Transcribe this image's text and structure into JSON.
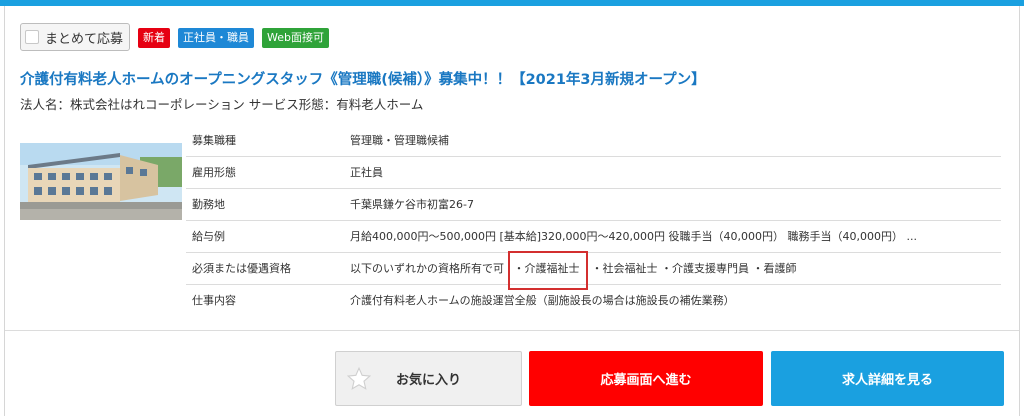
{
  "header": {
    "bulk_apply_label": "まとめて応募",
    "badges": {
      "new": "新着",
      "employment": "正社員・職員",
      "web_interview": "Web面接可"
    }
  },
  "job": {
    "title": "介護付有料老人ホームのオープニングスタッフ《管理職(候補）》募集中！！【2021年3月新規オープン】",
    "corp_line": "法人名：株式会社はれコーポレーション サービス形態：有料老人ホーム"
  },
  "details": {
    "rows": [
      {
        "label": "募集職種",
        "value": "管理職・管理職候補"
      },
      {
        "label": "雇用形態",
        "value": "正社員"
      },
      {
        "label": "勤務地",
        "value": "千葉県鎌ケ谷市初富26-7"
      },
      {
        "label": "給与例",
        "value": "月給400,000円～500,000円 [基本給]320,000円～420,000円 役職手当（40,000円） 職務手当（40,000円） ..."
      },
      {
        "label": "必須または優遇資格",
        "prefix": "以下のいずれかの資格所有で可 ",
        "highlighted": "・介護福祉士",
        "suffix": "・社会福祉士 ・介護支援専門員 ・看護師"
      },
      {
        "label": "仕事内容",
        "value": "介護付有料老人ホームの施設運営全般（副施設長の場合は施設長の補佐業務）"
      }
    ]
  },
  "actions": {
    "favorite_label": "お気に入り",
    "apply_label": "応募画面へ進む",
    "detail_label": "求人詳細を見る"
  },
  "colors": {
    "accent_blue": "#1aa0e0",
    "title_blue": "#1a78c2",
    "apply_red": "#ff0000",
    "badge_new": "#e60012",
    "badge_employment": "#1e88d6",
    "badge_web": "#2fa339",
    "highlight_border": "#d32f2f"
  }
}
